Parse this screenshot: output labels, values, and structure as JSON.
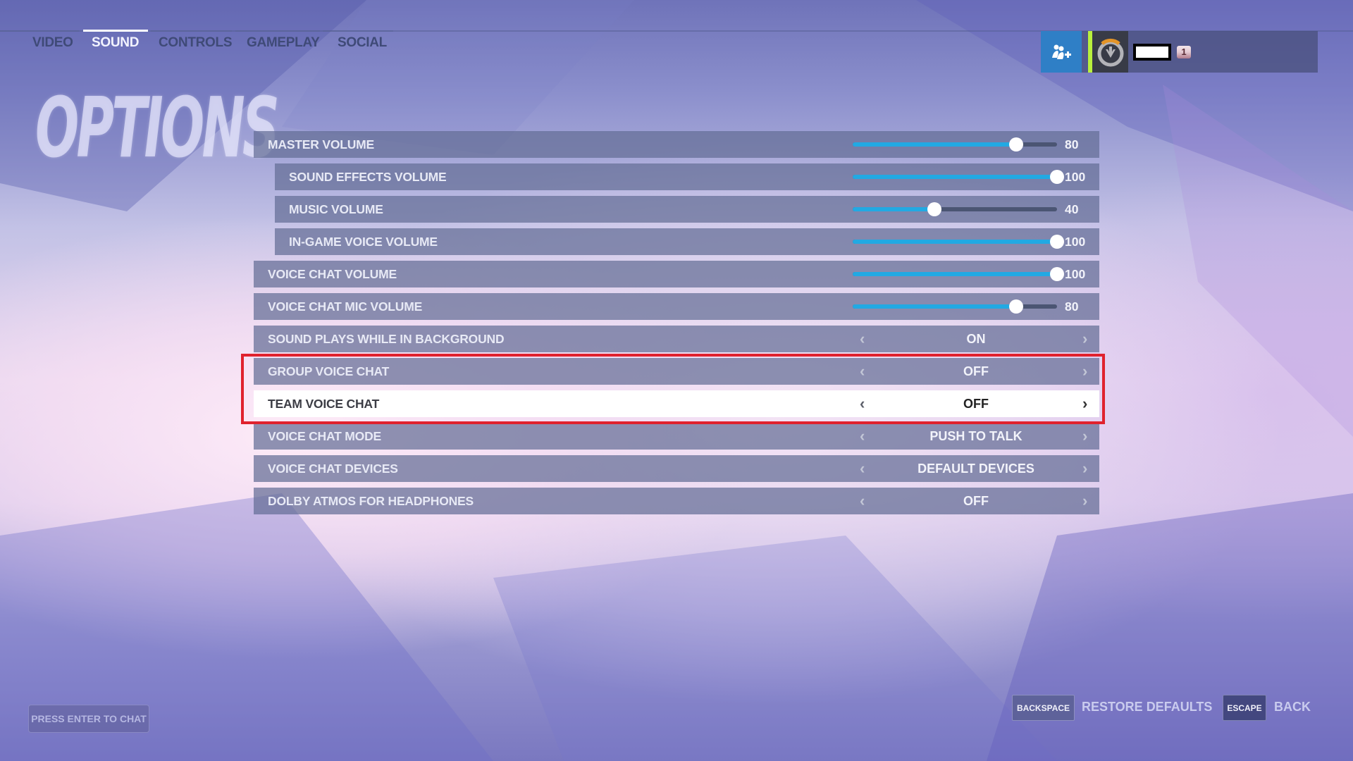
{
  "nav": {
    "tabs": [
      {
        "label": "VIDEO",
        "active": false
      },
      {
        "label": "SOUND",
        "active": true
      },
      {
        "label": "CONTROLS",
        "active": false
      },
      {
        "label": "GAMEPLAY",
        "active": false
      },
      {
        "label": "SOCIAL",
        "active": false
      }
    ]
  },
  "page_title": "OPTIONS",
  "profile": {
    "social_icon": "add-friends-icon",
    "avatar_icon": "overwatch-logo-icon",
    "name": "",
    "level": "1",
    "status_color": "#b9f03c",
    "social_color": "#2f7fc6"
  },
  "settings": [
    {
      "label": "MASTER VOLUME",
      "type": "slider",
      "value": 80,
      "display": "80",
      "sub": false
    },
    {
      "label": "SOUND EFFECTS VOLUME",
      "type": "slider",
      "value": 100,
      "display": "100",
      "sub": true
    },
    {
      "label": "MUSIC VOLUME",
      "type": "slider",
      "value": 40,
      "display": "40",
      "sub": true
    },
    {
      "label": "IN-GAME VOICE VOLUME",
      "type": "slider",
      "value": 100,
      "display": "100",
      "sub": true
    },
    {
      "label": "VOICE CHAT VOLUME",
      "type": "slider",
      "value": 100,
      "display": "100",
      "sub": false
    },
    {
      "label": "VOICE CHAT MIC VOLUME",
      "type": "slider",
      "value": 80,
      "display": "80",
      "sub": false
    },
    {
      "label": "SOUND PLAYS WHILE IN BACKGROUND",
      "type": "choice",
      "display": "ON",
      "sub": false
    },
    {
      "label": "GROUP VOICE CHAT",
      "type": "choice",
      "display": "OFF",
      "sub": false
    },
    {
      "label": "TEAM VOICE CHAT",
      "type": "choice",
      "display": "OFF",
      "sub": false,
      "selected": true
    },
    {
      "label": "VOICE CHAT MODE",
      "type": "choice",
      "display": "PUSH TO TALK",
      "sub": false
    },
    {
      "label": "VOICE CHAT DEVICES",
      "type": "choice",
      "display": "DEFAULT DEVICES",
      "sub": false
    },
    {
      "label": "DOLBY ATMOS FOR HEADPHONES",
      "type": "choice",
      "display": "OFF",
      "sub": false
    }
  ],
  "slider_range": [
    0,
    100
  ],
  "colors": {
    "slider_fill": "#22a9e3",
    "highlight_box": "#e0222e"
  },
  "footer": {
    "chat_placeholder": "PRESS ENTER TO CHAT",
    "restore_key": "BACKSPACE",
    "restore_label": "RESTORE DEFAULTS",
    "back_key": "ESCAPE",
    "back_label": "BACK"
  }
}
